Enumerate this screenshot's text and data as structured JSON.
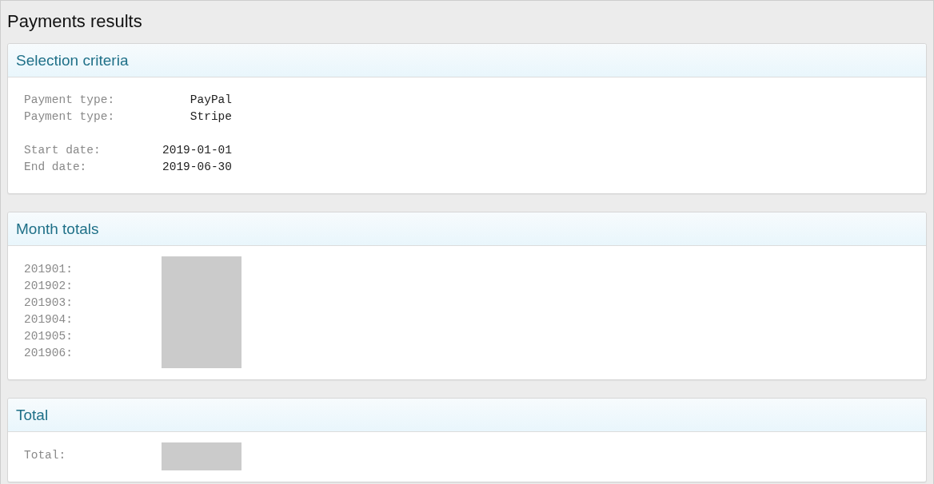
{
  "page_title": "Payments results",
  "panels": [
    {
      "kind": "criteria",
      "title": "Selection criteria",
      "groups": [
        [
          {
            "label": "Payment type:",
            "value": "PayPal"
          },
          {
            "label": "Payment type:",
            "value": "Stripe"
          }
        ],
        [
          {
            "label": "Start date:",
            "value": "2019-01-01"
          },
          {
            "label": "End date:",
            "value": "2019-06-30"
          }
        ]
      ]
    },
    {
      "kind": "redacted_list",
      "title": "Month totals",
      "labels": [
        "201901:",
        "201902:",
        "201903:",
        "201904:",
        "201905:",
        "201906:"
      ],
      "values_redacted": true
    },
    {
      "kind": "redacted_list",
      "title": "Total",
      "labels": [
        "Total:"
      ],
      "values_redacted": true
    }
  ]
}
